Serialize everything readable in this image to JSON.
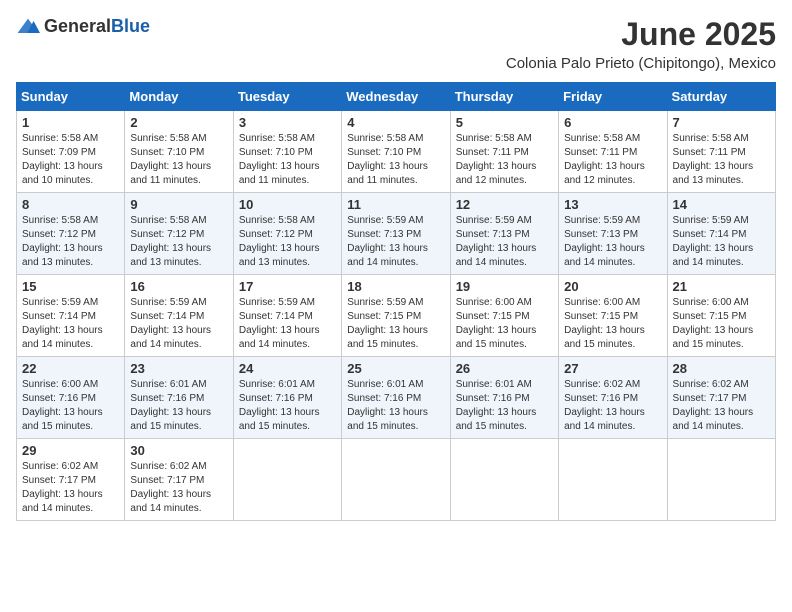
{
  "logo": {
    "general": "General",
    "blue": "Blue"
  },
  "title": "June 2025",
  "location": "Colonia Palo Prieto (Chipitongo), Mexico",
  "days_header": [
    "Sunday",
    "Monday",
    "Tuesday",
    "Wednesday",
    "Thursday",
    "Friday",
    "Saturday"
  ],
  "weeks": [
    [
      {
        "day": "1",
        "rise": "Sunrise: 5:58 AM",
        "set": "Sunset: 7:09 PM",
        "daylight": "Daylight: 13 hours and 10 minutes."
      },
      {
        "day": "2",
        "rise": "Sunrise: 5:58 AM",
        "set": "Sunset: 7:10 PM",
        "daylight": "Daylight: 13 hours and 11 minutes."
      },
      {
        "day": "3",
        "rise": "Sunrise: 5:58 AM",
        "set": "Sunset: 7:10 PM",
        "daylight": "Daylight: 13 hours and 11 minutes."
      },
      {
        "day": "4",
        "rise": "Sunrise: 5:58 AM",
        "set": "Sunset: 7:10 PM",
        "daylight": "Daylight: 13 hours and 11 minutes."
      },
      {
        "day": "5",
        "rise": "Sunrise: 5:58 AM",
        "set": "Sunset: 7:11 PM",
        "daylight": "Daylight: 13 hours and 12 minutes."
      },
      {
        "day": "6",
        "rise": "Sunrise: 5:58 AM",
        "set": "Sunset: 7:11 PM",
        "daylight": "Daylight: 13 hours and 12 minutes."
      },
      {
        "day": "7",
        "rise": "Sunrise: 5:58 AM",
        "set": "Sunset: 7:11 PM",
        "daylight": "Daylight: 13 hours and 13 minutes."
      }
    ],
    [
      {
        "day": "8",
        "rise": "Sunrise: 5:58 AM",
        "set": "Sunset: 7:12 PM",
        "daylight": "Daylight: 13 hours and 13 minutes."
      },
      {
        "day": "9",
        "rise": "Sunrise: 5:58 AM",
        "set": "Sunset: 7:12 PM",
        "daylight": "Daylight: 13 hours and 13 minutes."
      },
      {
        "day": "10",
        "rise": "Sunrise: 5:58 AM",
        "set": "Sunset: 7:12 PM",
        "daylight": "Daylight: 13 hours and 13 minutes."
      },
      {
        "day": "11",
        "rise": "Sunrise: 5:59 AM",
        "set": "Sunset: 7:13 PM",
        "daylight": "Daylight: 13 hours and 14 minutes."
      },
      {
        "day": "12",
        "rise": "Sunrise: 5:59 AM",
        "set": "Sunset: 7:13 PM",
        "daylight": "Daylight: 13 hours and 14 minutes."
      },
      {
        "day": "13",
        "rise": "Sunrise: 5:59 AM",
        "set": "Sunset: 7:13 PM",
        "daylight": "Daylight: 13 hours and 14 minutes."
      },
      {
        "day": "14",
        "rise": "Sunrise: 5:59 AM",
        "set": "Sunset: 7:14 PM",
        "daylight": "Daylight: 13 hours and 14 minutes."
      }
    ],
    [
      {
        "day": "15",
        "rise": "Sunrise: 5:59 AM",
        "set": "Sunset: 7:14 PM",
        "daylight": "Daylight: 13 hours and 14 minutes."
      },
      {
        "day": "16",
        "rise": "Sunrise: 5:59 AM",
        "set": "Sunset: 7:14 PM",
        "daylight": "Daylight: 13 hours and 14 minutes."
      },
      {
        "day": "17",
        "rise": "Sunrise: 5:59 AM",
        "set": "Sunset: 7:14 PM",
        "daylight": "Daylight: 13 hours and 14 minutes."
      },
      {
        "day": "18",
        "rise": "Sunrise: 5:59 AM",
        "set": "Sunset: 7:15 PM",
        "daylight": "Daylight: 13 hours and 15 minutes."
      },
      {
        "day": "19",
        "rise": "Sunrise: 6:00 AM",
        "set": "Sunset: 7:15 PM",
        "daylight": "Daylight: 13 hours and 15 minutes."
      },
      {
        "day": "20",
        "rise": "Sunrise: 6:00 AM",
        "set": "Sunset: 7:15 PM",
        "daylight": "Daylight: 13 hours and 15 minutes."
      },
      {
        "day": "21",
        "rise": "Sunrise: 6:00 AM",
        "set": "Sunset: 7:15 PM",
        "daylight": "Daylight: 13 hours and 15 minutes."
      }
    ],
    [
      {
        "day": "22",
        "rise": "Sunrise: 6:00 AM",
        "set": "Sunset: 7:16 PM",
        "daylight": "Daylight: 13 hours and 15 minutes."
      },
      {
        "day": "23",
        "rise": "Sunrise: 6:01 AM",
        "set": "Sunset: 7:16 PM",
        "daylight": "Daylight: 13 hours and 15 minutes."
      },
      {
        "day": "24",
        "rise": "Sunrise: 6:01 AM",
        "set": "Sunset: 7:16 PM",
        "daylight": "Daylight: 13 hours and 15 minutes."
      },
      {
        "day": "25",
        "rise": "Sunrise: 6:01 AM",
        "set": "Sunset: 7:16 PM",
        "daylight": "Daylight: 13 hours and 15 minutes."
      },
      {
        "day": "26",
        "rise": "Sunrise: 6:01 AM",
        "set": "Sunset: 7:16 PM",
        "daylight": "Daylight: 13 hours and 15 minutes."
      },
      {
        "day": "27",
        "rise": "Sunrise: 6:02 AM",
        "set": "Sunset: 7:16 PM",
        "daylight": "Daylight: 13 hours and 14 minutes."
      },
      {
        "day": "28",
        "rise": "Sunrise: 6:02 AM",
        "set": "Sunset: 7:17 PM",
        "daylight": "Daylight: 13 hours and 14 minutes."
      }
    ],
    [
      {
        "day": "29",
        "rise": "Sunrise: 6:02 AM",
        "set": "Sunset: 7:17 PM",
        "daylight": "Daylight: 13 hours and 14 minutes."
      },
      {
        "day": "30",
        "rise": "Sunrise: 6:02 AM",
        "set": "Sunset: 7:17 PM",
        "daylight": "Daylight: 13 hours and 14 minutes."
      },
      null,
      null,
      null,
      null,
      null
    ]
  ]
}
